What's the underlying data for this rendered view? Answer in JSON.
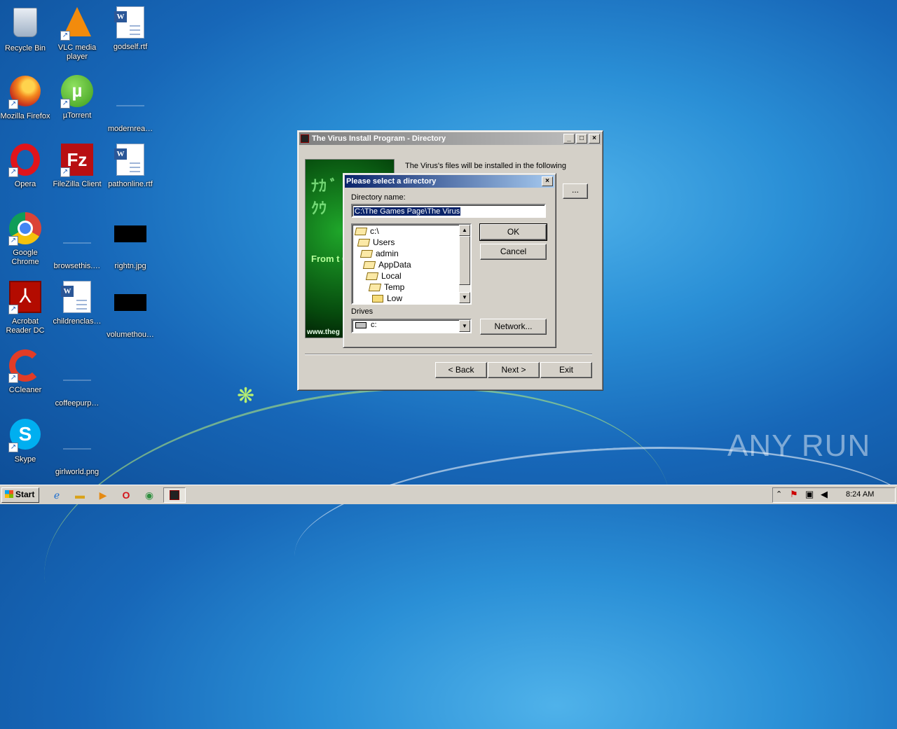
{
  "desktop": {
    "icons": [
      {
        "label": "Recycle Bin",
        "icon": "recycle-bin-icon"
      },
      {
        "label": "VLC media player",
        "icon": "vlc-icon"
      },
      {
        "label": "godself.rtf",
        "icon": "word-document-icon"
      },
      {
        "label": "Mozilla Firefox",
        "icon": "firefox-icon"
      },
      {
        "label": "µTorrent",
        "icon": "utorrent-icon"
      },
      {
        "label": "modernrea…",
        "icon": "blank-file-icon"
      },
      {
        "label": "Opera",
        "icon": "opera-icon"
      },
      {
        "label": "FileZilla Client",
        "icon": "filezilla-icon"
      },
      {
        "label": "pathonline.rtf",
        "icon": "word-document-icon"
      },
      {
        "label": "Google Chrome",
        "icon": "chrome-icon"
      },
      {
        "label": "browsethis.…",
        "icon": "blank-file-icon"
      },
      {
        "label": "rightn.jpg",
        "icon": "image-file-icon"
      },
      {
        "label": "Acrobat Reader DC",
        "icon": "acrobat-icon"
      },
      {
        "label": "childrenclas…",
        "icon": "word-document-icon"
      },
      {
        "label": "volumethou…",
        "icon": "image-file-icon"
      },
      {
        "label": "CCleaner",
        "icon": "ccleaner-icon"
      },
      {
        "label": "coffeepurp…",
        "icon": "blank-file-icon"
      },
      {
        "label": "Skype",
        "icon": "skype-icon"
      },
      {
        "label": "girlworld.png",
        "icon": "blank-file-icon"
      }
    ]
  },
  "installer": {
    "title": "The Virus Install Program - Directory",
    "intro_text": "The Virus's files will be installed in the following",
    "browse_label": "...",
    "banner_text": "From t Old",
    "banner_url": "www.theg",
    "back_label": "< Back",
    "next_label": "Next >",
    "exit_label": "Exit"
  },
  "dir_dialog": {
    "title": "Please select a directory",
    "directory_label": "Directory name:",
    "directory_value": "C:\\The Games Page\\The Virus",
    "tree": [
      "c:\\",
      "Users",
      "admin",
      "AppData",
      "Local",
      "Temp",
      "Low"
    ],
    "drives_label": "Drives",
    "drive_value": "c:",
    "ok_label": "OK",
    "cancel_label": "Cancel",
    "network_label": "Network..."
  },
  "taskbar": {
    "start_label": "Start",
    "clock": "8:24 AM"
  },
  "watermark": "ANY RUN"
}
